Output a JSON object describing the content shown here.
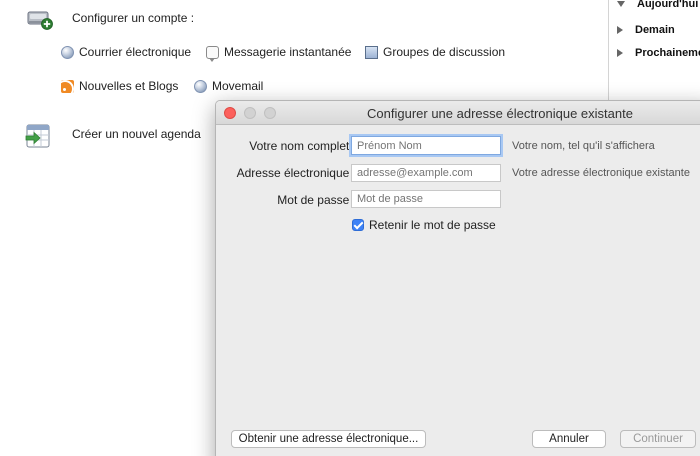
{
  "setup": {
    "configure_label": "Configurer un compte :",
    "accounts": {
      "email": "Courrier électronique",
      "chat": "Messagerie instantanée",
      "newsgroups": "Groupes de discussion",
      "feeds": "Nouvelles et Blogs",
      "movemail": "Movemail"
    },
    "calendar_label": "Créer un nouvel agenda"
  },
  "agenda": {
    "items": [
      {
        "label": "Aujourd'hui",
        "expanded": true
      },
      {
        "label": "Demain",
        "expanded": false
      },
      {
        "label": "Prochainement",
        "expanded": false
      }
    ]
  },
  "dialog": {
    "title": "Configurer une adresse électronique existante",
    "fields": {
      "name_label": "Votre nom complet :",
      "name_placeholder": "Prénom Nom",
      "name_hint": "Votre nom, tel qu'il s'affichera",
      "email_label": "Adresse électronique :",
      "email_placeholder": "adresse@example.com",
      "email_hint": "Votre adresse électronique existante",
      "password_label": "Mot de passe :",
      "password_placeholder": "Mot de passe"
    },
    "remember_password_label": "Retenir le mot de passe",
    "remember_password_checked": true,
    "buttons": {
      "get_address": "Obtenir une adresse électronique...",
      "cancel": "Annuler",
      "continue": "Continuer"
    }
  },
  "colors": {
    "close_button": "#fc605c",
    "checkbox_accent": "#3d82f6",
    "focus_ring": "#a8c8f3",
    "rss_orange": "#f08a24"
  },
  "icons": {
    "configure": "drive-add-icon",
    "calendar": "calendar-add-icon"
  }
}
